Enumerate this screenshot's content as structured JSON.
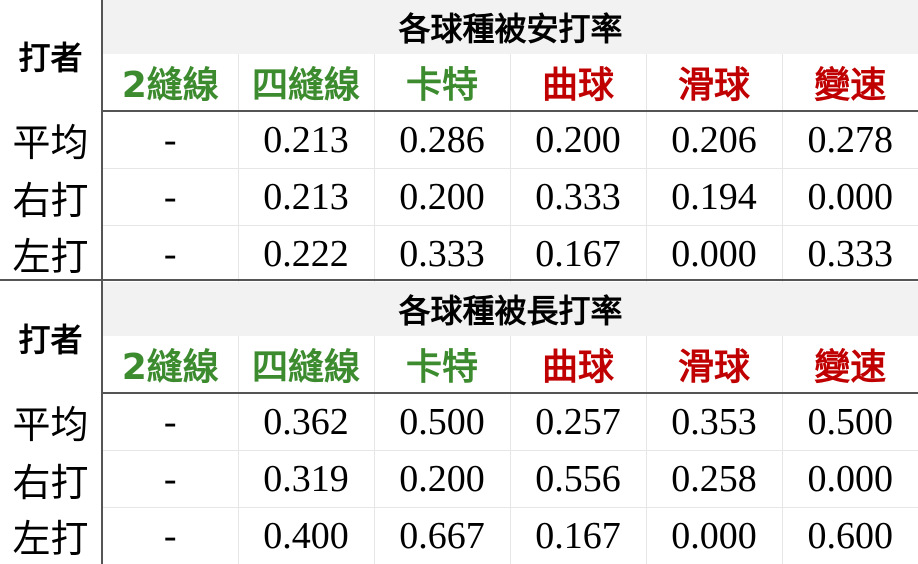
{
  "batter_label": "打者",
  "tables": [
    {
      "title": "各球種被安打率",
      "pitches": [
        {
          "label": "2縫線",
          "group": "fastball"
        },
        {
          "label": "四縫線",
          "group": "fastball"
        },
        {
          "label": "卡特",
          "group": "fastball"
        },
        {
          "label": "曲球",
          "group": "offspeed"
        },
        {
          "label": "滑球",
          "group": "offspeed"
        },
        {
          "label": "變速",
          "group": "offspeed"
        }
      ],
      "rows": [
        {
          "label": "平均",
          "values": [
            "-",
            "0.213",
            "0.286",
            "0.200",
            "0.206",
            "0.278"
          ]
        },
        {
          "label": "右打",
          "values": [
            "-",
            "0.213",
            "0.200",
            "0.333",
            "0.194",
            "0.000"
          ]
        },
        {
          "label": "左打",
          "values": [
            "-",
            "0.222",
            "0.333",
            "0.167",
            "0.000",
            "0.333"
          ]
        }
      ]
    },
    {
      "title": "各球種被長打率",
      "pitches": [
        {
          "label": "2縫線",
          "group": "fastball"
        },
        {
          "label": "四縫線",
          "group": "fastball"
        },
        {
          "label": "卡特",
          "group": "fastball"
        },
        {
          "label": "曲球",
          "group": "offspeed"
        },
        {
          "label": "滑球",
          "group": "offspeed"
        },
        {
          "label": "變速",
          "group": "offspeed"
        }
      ],
      "rows": [
        {
          "label": "平均",
          "values": [
            "-",
            "0.362",
            "0.500",
            "0.257",
            "0.353",
            "0.500"
          ]
        },
        {
          "label": "右打",
          "values": [
            "-",
            "0.319",
            "0.200",
            "0.556",
            "0.258",
            "0.000"
          ]
        },
        {
          "label": "左打",
          "values": [
            "-",
            "0.400",
            "0.667",
            "0.167",
            "0.000",
            "0.600"
          ]
        }
      ]
    }
  ],
  "colors": {
    "fastball": "#3d8b2f",
    "offspeed": "#c00000",
    "title_background": "#f2f2f2",
    "rule": "#555555"
  }
}
